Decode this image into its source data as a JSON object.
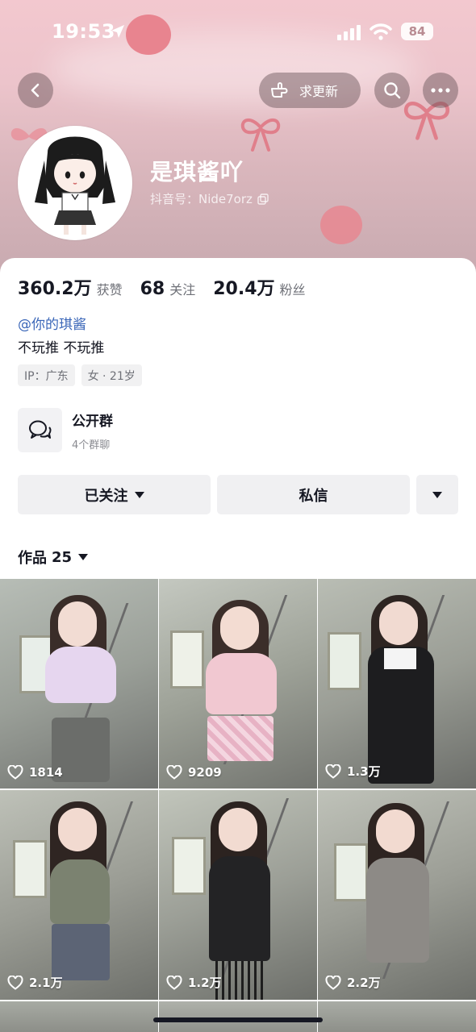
{
  "status_bar": {
    "time": "19:53",
    "battery": "84",
    "icons": [
      "location-arrow-icon",
      "signal-icon",
      "wifi-icon",
      "battery-icon"
    ]
  },
  "top_bar": {
    "back_icon": "chevron-left-icon",
    "request_update_label": "求更新",
    "search_icon": "search-icon",
    "more_icon": "more-dots-icon"
  },
  "profile": {
    "name": "是琪酱吖",
    "douyin_id": "抖音号：Nide7orz",
    "stats": [
      {
        "value": "360.2万",
        "label": "获赞"
      },
      {
        "value": "68",
        "label": "关注"
      },
      {
        "value": "20.4万",
        "label": "粉丝"
      }
    ],
    "mention": "@你的琪酱",
    "bio": "不玩推 不玩推",
    "tags": [
      "IP：广东",
      "女 · 21岁"
    ]
  },
  "group": {
    "title": "公开群",
    "subtitle": "4个群聊"
  },
  "actions": {
    "follow_label": "已关注",
    "message_label": "私信"
  },
  "works": {
    "label": "作品",
    "count": "25"
  },
  "videos": [
    {
      "likes": "1814"
    },
    {
      "likes": "9209"
    },
    {
      "likes": "1.3万"
    },
    {
      "likes": "2.1万"
    },
    {
      "likes": "1.2万"
    },
    {
      "likes": "2.2万"
    }
  ],
  "colors": {
    "header_pink": "#ecc4cb",
    "accent_link": "#3a66b8",
    "text_primary": "#161823",
    "text_secondary": "#6f7178"
  }
}
